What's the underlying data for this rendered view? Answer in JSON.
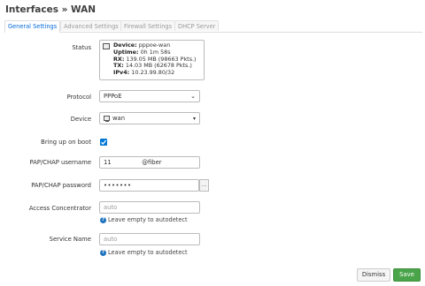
{
  "page": {
    "title": "Interfaces » WAN"
  },
  "tabs": [
    {
      "label": "General Settings"
    },
    {
      "label": "Advanced Settings"
    },
    {
      "label": "Firewall Settings"
    },
    {
      "label": "DHCP Server"
    }
  ],
  "form": {
    "status": {
      "label": "Status",
      "device_key": "Device:",
      "device_val": "pppoe-wan",
      "uptime_key": "Uptime:",
      "uptime_val": "0h 1m 58s",
      "rx_key": "RX:",
      "rx_val": "139.05 MB (98663 Pkts.)",
      "tx_key": "TX:",
      "tx_val": "14.03 MB (62678 Pkts.)",
      "ipv4_key": "IPv4:",
      "ipv4_val": "10.23.99.80/32"
    },
    "protocol": {
      "label": "Protocol",
      "value": "PPPoE"
    },
    "device": {
      "label": "Device",
      "value": "wan"
    },
    "bring_up": {
      "label": "Bring up on boot",
      "checked": true
    },
    "username": {
      "label": "PAP/CHAP username",
      "value": "11                @fiber"
    },
    "password": {
      "label": "PAP/CHAP password",
      "value": "•••••••"
    },
    "access_concentrator": {
      "label": "Access Concentrator",
      "placeholder": "auto",
      "hint": "Leave empty to autodetect"
    },
    "service_name": {
      "label": "Service Name",
      "placeholder": "auto",
      "hint": "Leave empty to autodetect"
    }
  },
  "actions": {
    "dismiss": "Dismiss",
    "save": "Save"
  },
  "colors": {
    "accent": "#0069d6",
    "save": "#4aa54a",
    "checkbox": "#0078d7"
  },
  "icons": [
    "network-device-icon",
    "chevron-down-icon",
    "checkmark-icon",
    "help-icon"
  ]
}
